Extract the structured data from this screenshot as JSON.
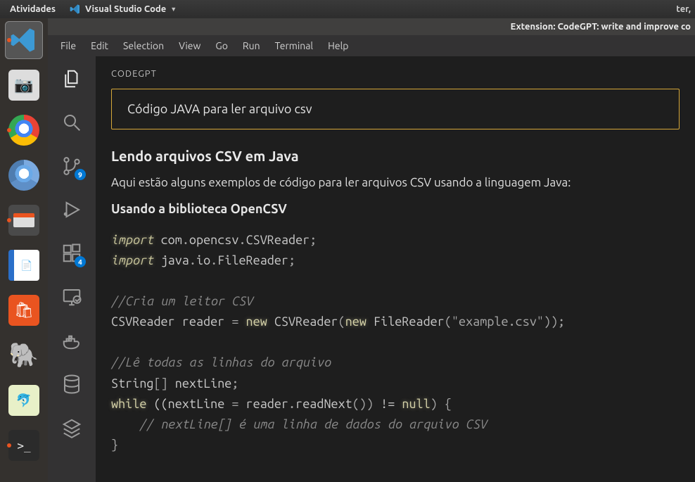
{
  "gnome": {
    "activities": "Atividades",
    "app_name": "Visual Studio Code",
    "clock": "ter,"
  },
  "window_title": "Extension: CodeGPT: write and improve co",
  "menu": [
    "File",
    "Edit",
    "Selection",
    "View",
    "Go",
    "Run",
    "Terminal",
    "Help"
  ],
  "activity_badges": {
    "scm": "9",
    "extensions": "4"
  },
  "panel": {
    "title": "CODEGPT",
    "prompt": "Código JAVA para ler arquivo csv",
    "h1": "Lendo arquivos CSV em Java",
    "p1": "Aqui estão alguns exemplos de código para ler arquivos CSV usando a linguagem Java:",
    "h2": "Usando a biblioteca OpenCSV"
  },
  "code": {
    "kw_import": "import",
    "l1_a": " com",
    "dot": ".",
    "l1_b": "opencsv",
    "l1_c": "CSVReader",
    "semi": ";",
    "l2_a": " java",
    "l2_b": "io",
    "l2_c": "FileReader",
    "c1": "//Cria um leitor CSV",
    "l3_a": "CSVReader reader ",
    "eq": "=",
    "kw_new": "new",
    "l3_b": " CSVReader",
    "lp": "(",
    "rp": ")",
    "l3_c": " FileReader",
    "l3_str": "\"example.csv\"",
    "c2": "//Lê todas as linhas do arquivo",
    "l4": "String",
    "l4_br": "[] ",
    "l4_b": "nextLine",
    "kw_while": "while",
    "l5_a": " ((nextLine ",
    "l5_b": " reader",
    "l5_c": "readNext",
    "l5_par": "()",
    "l5_ne": " != ",
    "kw_null": "null",
    "l5_end": ") {",
    "c3": "    // nextLine[] é uma linha de dados do arquivo CSV",
    "rb": "}"
  }
}
